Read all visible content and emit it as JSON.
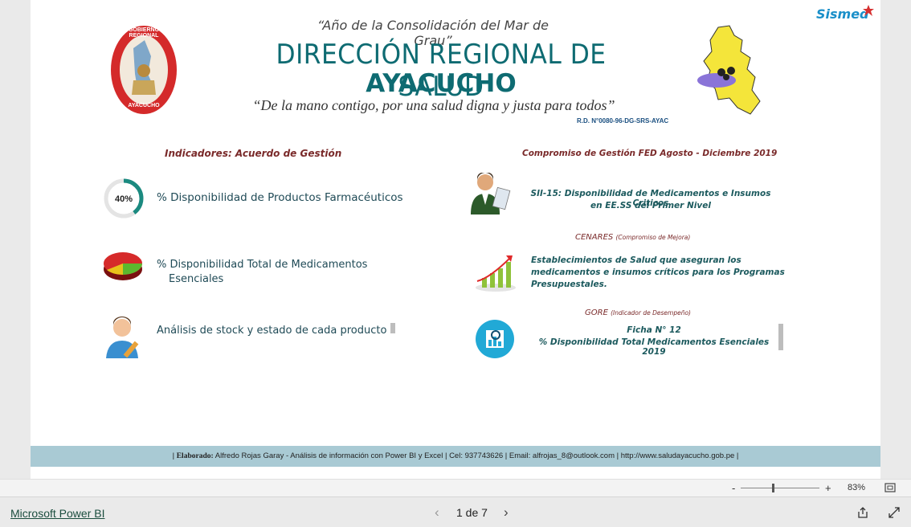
{
  "header": {
    "motto_top": "“Año de la Consolidación del Mar de Grau”",
    "title_line1": "DIRECCIÓN REGIONAL DE SALUD",
    "title_line2": "AYACUCHO",
    "motto_bottom": "“De la mano contigo, por una salud digna y justa para todos”",
    "resolution": "R.D. N°0080-96-DG-SRS-AYAC",
    "seal_text_top": "GOBIERNO REGIONAL",
    "seal_text_bottom": "AYACUCHO",
    "brand_logo": "Sismed"
  },
  "left_panel": {
    "heading": "Indicadores: Acuerdo de Gestión",
    "items": [
      {
        "icon": "progress-ring-icon",
        "badge": "40%",
        "progress": 0.4,
        "label": "% Disponibilidad de Productos Farmacéuticos"
      },
      {
        "icon": "pie-chart-icon",
        "label_line1": "% Disponibilidad Total de Medicamentos",
        "label_line2": "Esenciales"
      },
      {
        "icon": "user-edit-icon",
        "label": "Análisis de stock y estado de cada producto"
      }
    ]
  },
  "right_panel": {
    "heading": "Compromiso de Gestión FED  Agosto - Diciembre 2019",
    "items": [
      {
        "icon": "doctor-icon",
        "line1": "SII-15: Disponibilidad de Medicamentos e Insumos Criticos",
        "line2": "en EE.SS del Primer Nivel"
      },
      {
        "section_title": "CENARES",
        "section_note": "(Compromiso de Mejora)",
        "icon": "growth-chart-icon",
        "line1": "Establecimientos de Salud que aseguran los",
        "line2": "medicamentos e insumos críticos para los Programas",
        "line3": "Presupuestales."
      },
      {
        "section_title": "GORE",
        "section_note": "(Indicador de Desempeño)",
        "icon": "analytics-icon",
        "line1": "Ficha N° 12",
        "line2": "% Disponibilidad Total Medicamentos Esenciales 2019"
      }
    ]
  },
  "footer": {
    "label": "Elaborado:",
    "text": "Alfredo Rojas Garay - Análisis de información con Power BI y Excel | Cel: 937743626 | Email: alfrojas_8@outlook.com  | http://www.saludayacucho.gob.pe |"
  },
  "viewer": {
    "zoom_minus": "-",
    "zoom_plus": "+",
    "zoom_level": "83%",
    "zoom_fraction": 0.4,
    "brand_link": "Microsoft Power BI",
    "page_indicator": "1 de 7",
    "prev": "‹",
    "next": "›"
  },
  "colors": {
    "teal": "#0e6b72",
    "footer": "#a9cad4",
    "ring": "#1b8a80",
    "heading_red": "#7a2a2a"
  }
}
